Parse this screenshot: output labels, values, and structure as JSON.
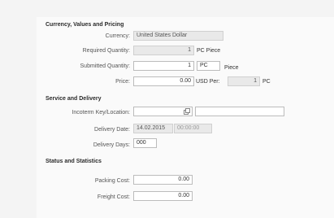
{
  "sections": {
    "currency": "Currency, Values and Pricing",
    "service": "Service and Delivery",
    "status": "Status and Statistics"
  },
  "currency": {
    "currency_label": "Currency:",
    "currency_value": "United States Dollar",
    "required_qty_label": "Required Quantity:",
    "required_qty_value": "1",
    "required_qty_unit": "PC Piece",
    "submitted_qty_label": "Submitted Quantity:",
    "submitted_qty_value": "1",
    "submitted_qty_unit_code": "PC",
    "submitted_qty_unit_text": "Piece",
    "price_label": "Price:",
    "price_value": "0.00",
    "price_per_text": "USD Per:",
    "per_value": "1",
    "per_unit": "PC"
  },
  "service": {
    "incoterm_label": "Incoterm Key/Location:",
    "incoterm_key": "",
    "incoterm_location": "",
    "delivery_date_label": "Delivery Date:",
    "delivery_date_value": "14.02.2015",
    "delivery_time_value": "00:00:00",
    "delivery_days_label": "Delivery Days:",
    "delivery_days_value": "000"
  },
  "status": {
    "packing_cost_label": "Packing Cost:",
    "packing_cost_value": "0.00",
    "freight_cost_label": "Freight Cost:",
    "freight_cost_value": "0.00"
  },
  "icons": {
    "value_help": "value-help-icon"
  }
}
